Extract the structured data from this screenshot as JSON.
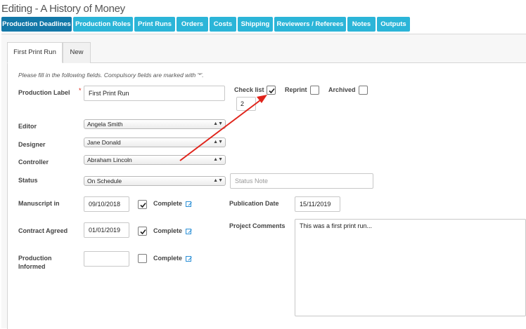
{
  "header": {
    "title": "Editing - A History of Money"
  },
  "nav": {
    "buttons": [
      {
        "label": "Production Deadlines",
        "active": true
      },
      {
        "label": "Production Roles"
      },
      {
        "label": "Print Runs"
      },
      {
        "label": "Orders"
      },
      {
        "label": "Costs"
      },
      {
        "label": "Shipping"
      },
      {
        "label": "Reviewers / Referees"
      },
      {
        "label": "Notes"
      },
      {
        "label": "Outputs"
      }
    ]
  },
  "tabs": [
    {
      "label": "First Print Run",
      "active": true
    },
    {
      "label": "New"
    }
  ],
  "form": {
    "hint": "Please fill in the following fields. Compulsory fields are marked with '*'.",
    "required_marker": "*",
    "production_label": {
      "label": "Production Label",
      "value": "First Print Run"
    },
    "checklist": {
      "label": "Check list",
      "checked": true,
      "count": "2"
    },
    "reprint": {
      "label": "Reprint",
      "checked": false
    },
    "archived": {
      "label": "Archived",
      "checked": false
    },
    "editor": {
      "label": "Editor",
      "value": "Angela Smith"
    },
    "designer": {
      "label": "Designer",
      "value": "Jane Donald"
    },
    "controller": {
      "label": "Controller",
      "value": "Abraham Lincoln"
    },
    "status": {
      "label": "Status",
      "value": "On Schedule",
      "note_placeholder": "Status Note"
    },
    "manuscript": {
      "label": "Manuscript in",
      "value": "09/10/2018",
      "complete_label": "Complete",
      "complete": true
    },
    "contract": {
      "label": "Contract Agreed",
      "value": "01/01/2019",
      "complete_label": "Complete",
      "complete": true
    },
    "production_informed": {
      "label_line1": "Production",
      "label_line2": "Informed",
      "value": "",
      "complete_label": "Complete",
      "complete": false
    },
    "publication_date": {
      "label": "Publication Date",
      "value": "15/11/2019"
    },
    "project_comments": {
      "label": "Project Comments",
      "value": "This was a first print run..."
    }
  },
  "colors": {
    "nav_button": "#2bb5d8",
    "nav_button_active": "#1378a8",
    "annotation_arrow": "#e0241b",
    "required": "#dd2211"
  }
}
